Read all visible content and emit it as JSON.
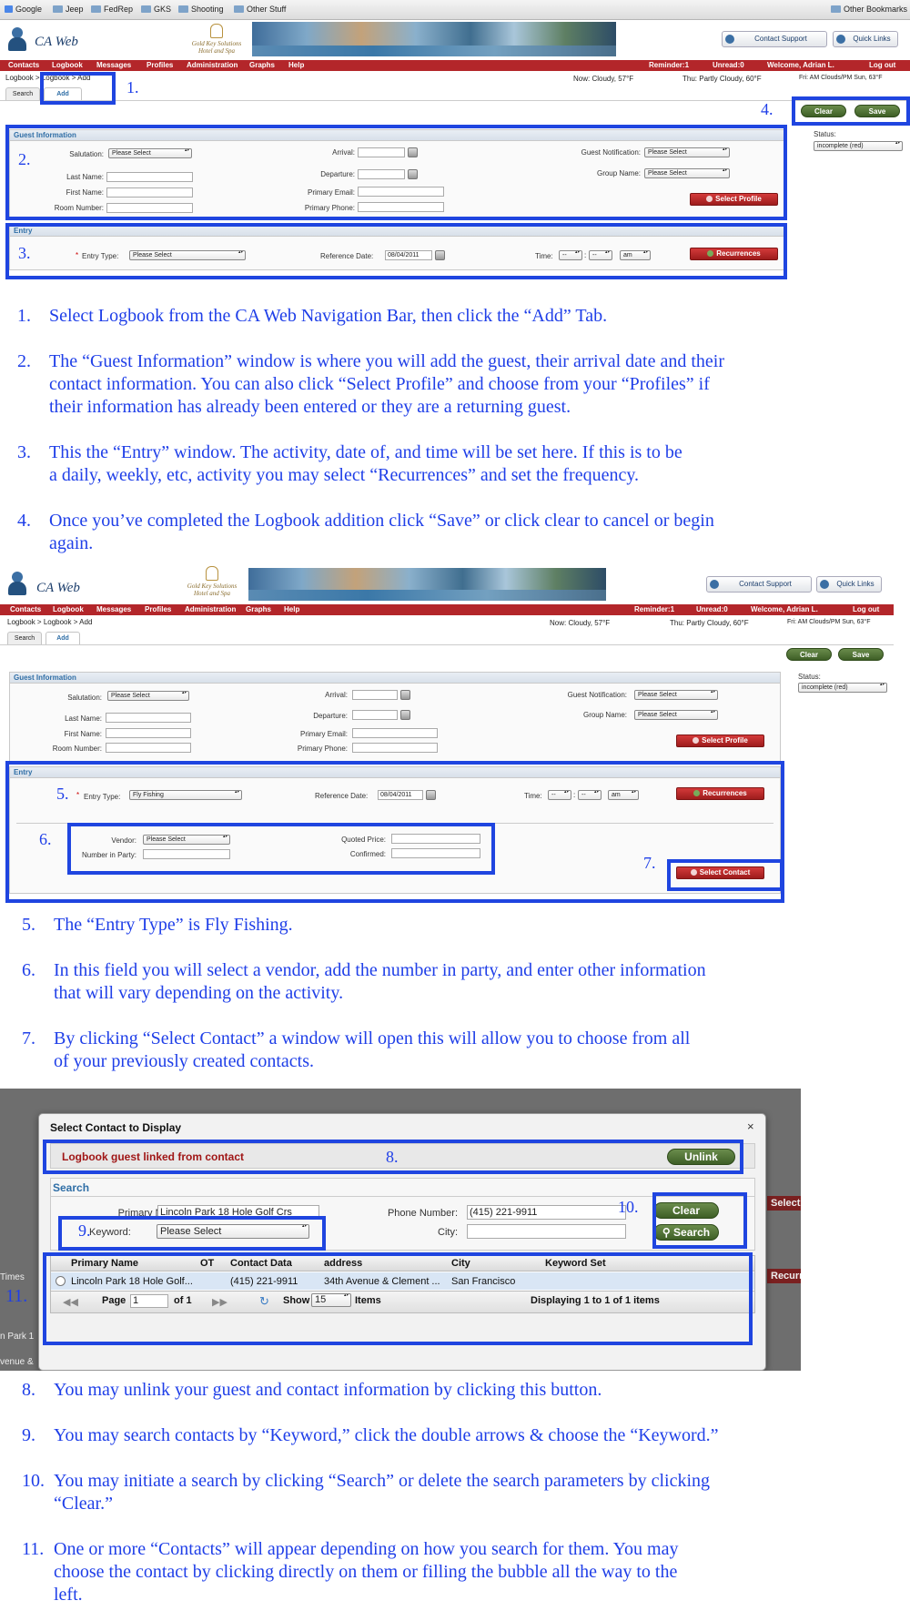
{
  "bookmarks": {
    "items": [
      "Google",
      "Jeep",
      "FedRep",
      "GKS",
      "Shooting",
      "Other Stuff"
    ],
    "right": "Other Bookmarks"
  },
  "app": {
    "title": "CA Web",
    "crest_line1": "Gold Key Solutions",
    "crest_line2": "Hotel and Spa",
    "contact_support": "Contact Support",
    "quick_links": "Quick Links"
  },
  "nav": {
    "items": [
      "Contacts",
      "Logbook",
      "Messages",
      "Profiles",
      "Administration",
      "Graphs",
      "Help"
    ],
    "reminder": "Reminder:1",
    "unread": "Unread:0",
    "welcome": "Welcome, Adrian L.",
    "logout": "Log out"
  },
  "crumb": "Logbook > Logbook > Add",
  "weather": {
    "now": "Now: Cloudy, 57°F",
    "thu": "Thu: Partly Cloudy, 60°F",
    "fri": "Fri: AM Clouds/PM Sun, 63°F"
  },
  "tabs": {
    "search": "Search",
    "add": "Add"
  },
  "actions": {
    "clear": "Clear",
    "save": "Save"
  },
  "status": {
    "label": "Status:",
    "value": "incomplete (red)"
  },
  "guest": {
    "title": "Guest Information",
    "salutation": "Salutation:",
    "last_name": "Last Name:",
    "first_name": "First Name:",
    "room_number": "Room Number:",
    "arrival": "Arrival:",
    "departure": "Departure:",
    "primary_email": "Primary Email:",
    "primary_phone": "Primary Phone:",
    "guest_notification": "Guest Notification:",
    "group_name": "Group Name:",
    "please_select": "Please Select",
    "select_profile": "Select Profile"
  },
  "entry": {
    "title": "Entry",
    "entry_type": "Entry Type:",
    "entry_type_value_1": "Please Select",
    "entry_type_value_2": "Fly Fishing",
    "reference_date": "Reference Date:",
    "reference_date_value": "08/04/2011",
    "time": "Time:",
    "time_h": "--",
    "time_m": "--",
    "time_ampm": "am",
    "time_sep": ":",
    "required": "*",
    "recurrences": "Recurrences",
    "vendor": "Vendor:",
    "vendor_value": "Please Select",
    "number_in_party": "Number in Party:",
    "quoted_price": "Quoted Price:",
    "confirmed": "Confirmed:",
    "select_contact": "Select Contact"
  },
  "callouts": [
    "1.",
    "2.",
    "3.",
    "4.",
    "5.",
    "6.",
    "7.",
    "8.",
    "9.",
    "10.",
    "11."
  ],
  "steps": [
    {
      "n": "1.",
      "lines": [
        "Select Logbook from the CA Web Navigation Bar, then click the “Add” Tab."
      ]
    },
    {
      "n": "2.",
      "lines": [
        "The “Guest Information” window is where you will add the guest, their arrival date and their",
        "contact information.  You can also click “Select Profile” and choose from your “Profiles” if",
        "their information has already been entered or they are a returning guest."
      ]
    },
    {
      "n": "3.",
      "lines": [
        "This the “Entry” window.  The activity, date of, and time will be set here.  If this is to be",
        "a daily, weekly, etc, activity you may select “Recurrences” and set the frequency."
      ]
    },
    {
      "n": "4.",
      "lines": [
        "Once you’ve completed the Logbook addition click “Save” or click clear to cancel or begin",
        "again."
      ]
    },
    {
      "n": "5.",
      "lines": [
        "The “Entry Type” is Fly Fishing."
      ]
    },
    {
      "n": "6.",
      "lines": [
        "In this field you will select a vendor, add the number in party, and enter other information",
        "that will vary depending on the activity."
      ]
    },
    {
      "n": "7.",
      "lines": [
        "By clicking “Select Contact” a window will open this will allow you to choose from all",
        "of your previously created contacts."
      ]
    },
    {
      "n": "8.",
      "lines": [
        "You may unlink your guest and contact information by clicking this button."
      ]
    },
    {
      "n": "9.",
      "lines": [
        "You may search contacts by “Keyword,” click the double arrows & choose the “Keyword.”"
      ]
    },
    {
      "n": "10.",
      "lines": [
        "You may initiate a search by clicking “Search” or delete the search parameters by clicking",
        "“Clear.”"
      ]
    },
    {
      "n": "11.",
      "lines": [
        "One or more “Contacts” will appear depending on how you search for them.  You may",
        "choose the contact by clicking directly on them or filling the bubble all the way to the",
        "left."
      ]
    }
  ],
  "dialog": {
    "title": "Select Contact to Display",
    "close": "×",
    "linked": "Logbook guest linked from contact",
    "unlink": "Unlink",
    "search_title": "Search",
    "primary_name": "Primary Name:",
    "primary_name_value": "Lincoln Park 18 Hole Golf Crs",
    "phone_number": "Phone Number:",
    "phone_value": "(415) 221-9911",
    "keyword": "Keyword:",
    "keyword_value": "Please Select",
    "city": "City:",
    "clear": "Clear",
    "search": "Search",
    "columns": [
      "Primary Name",
      "OT",
      "Contact Data",
      "address",
      "City",
      "Keyword Set"
    ],
    "row": [
      "Lincoln Park 18 Hole Golf...",
      "",
      "(415) 221-9911",
      "34th Avenue & Clement ...",
      "San Francisco",
      ""
    ],
    "pager": {
      "page": "Page",
      "page_value": "1",
      "of": "of 1",
      "show": "Show",
      "show_value": "15",
      "items": "Items",
      "displaying": "Displaying 1 to 1 of 1 items"
    },
    "bg_labels": {
      "times": "Times",
      "park": "n Park 1",
      "avenue": "venue &",
      "select": "Select",
      "recurr": "Recurr"
    }
  }
}
